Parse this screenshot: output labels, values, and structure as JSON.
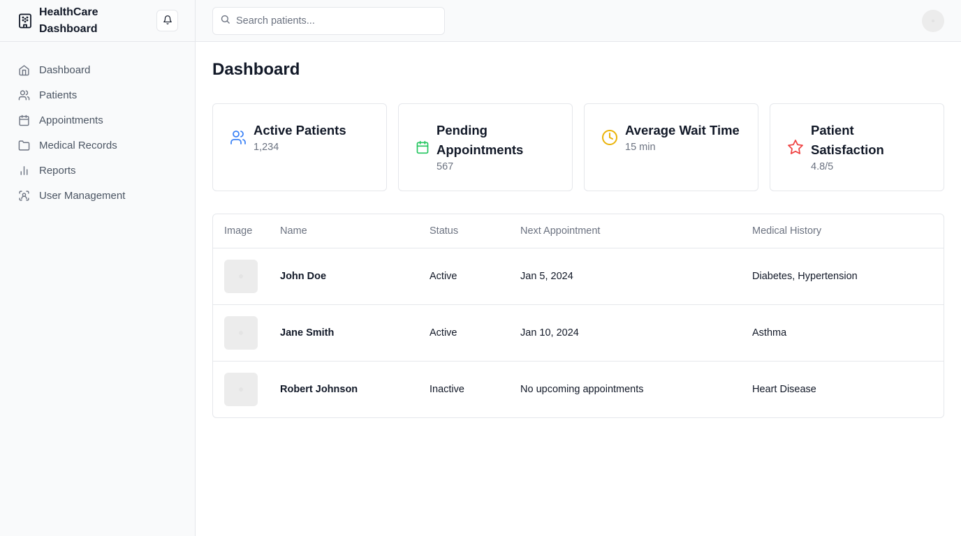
{
  "brand": {
    "title": "HealthCare Dashboard",
    "icon": "building-icon"
  },
  "header": {
    "search_placeholder": "Search patients...",
    "notification_icon": "bell-icon"
  },
  "sidebar": {
    "items": [
      {
        "label": "Dashboard",
        "icon": "home-icon"
      },
      {
        "label": "Patients",
        "icon": "users-icon"
      },
      {
        "label": "Appointments",
        "icon": "calendar-icon"
      },
      {
        "label": "Medical Records",
        "icon": "folder-icon"
      },
      {
        "label": "Reports",
        "icon": "bar-chart-icon"
      },
      {
        "label": "User Management",
        "icon": "scan-user-icon"
      }
    ]
  },
  "main": {
    "title": "Dashboard",
    "stats": [
      {
        "title": "Active Patients",
        "value": "1,234",
        "icon": "users-icon",
        "color": "#3b82f6"
      },
      {
        "title": "Pending Appointments",
        "value": "567",
        "icon": "calendar-icon",
        "color": "#22c55e"
      },
      {
        "title": "Average Wait Time",
        "value": "15 min",
        "icon": "clock-icon",
        "color": "#eab308"
      },
      {
        "title": "Patient Satisfaction",
        "value": "4.8/5",
        "icon": "star-icon",
        "color": "#ef4444"
      }
    ],
    "table": {
      "columns": [
        "Image",
        "Name",
        "Status",
        "Next Appointment",
        "Medical History"
      ],
      "rows": [
        {
          "name": "John Doe",
          "status": "Active",
          "next": "Jan 5, 2024",
          "history": "Diabetes, Hypertension"
        },
        {
          "name": "Jane Smith",
          "status": "Active",
          "next": "Jan 10, 2024",
          "history": "Asthma"
        },
        {
          "name": "Robert Johnson",
          "status": "Inactive",
          "next": "No upcoming appointments",
          "history": "Heart Disease"
        }
      ]
    }
  }
}
